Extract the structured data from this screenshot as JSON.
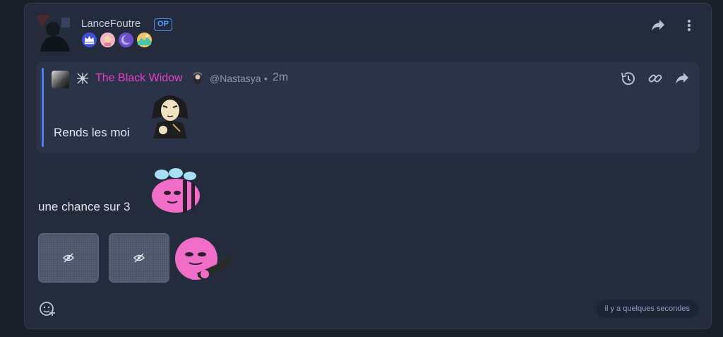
{
  "post": {
    "author": {
      "name": "LanceFoutre",
      "op_label": "OP",
      "badges": [
        "crown-badge",
        "character-badge",
        "moon-badge",
        "landscape-badge"
      ]
    },
    "actions": [
      "share-icon",
      "more-vertical-icon"
    ],
    "quote": {
      "author_name": "The Black Widow",
      "author_name_color": "#e640c8",
      "handle": "@Nastasya",
      "separator": "•",
      "time": "2m",
      "text": "Rends les moi",
      "actions": [
        "history-icon",
        "link-icon",
        "share-icon"
      ]
    },
    "message_text": "une chance sur 3",
    "timestamp": "il y a quelques secondes"
  },
  "colors": {
    "accent": "#4f7fe8",
    "background": "#1b1f2a",
    "card": "#232b3d",
    "quote_bg": "#2a3348"
  }
}
